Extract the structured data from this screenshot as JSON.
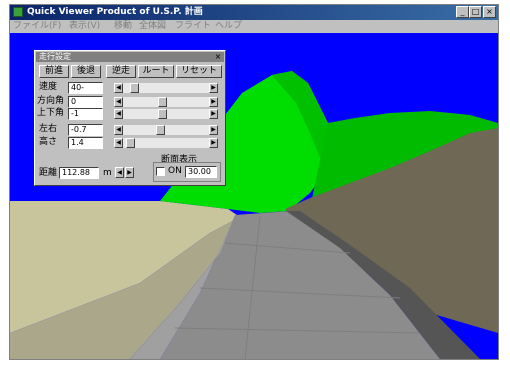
{
  "window": {
    "title": "Quick Viewer Product of U.S.P. 計画",
    "buttons": {
      "minimize": "_",
      "maximize": "□",
      "close": "×"
    }
  },
  "menu": [
    "ファイル(F)",
    "表示(V)",
    "移動",
    "全体図",
    "フライト",
    "ヘルプ"
  ],
  "panel": {
    "title": "走行設定",
    "close_glyph": "×",
    "buttons": [
      "前進",
      "後退",
      "逆走",
      "ルート",
      "リセット"
    ],
    "rows": [
      {
        "label": "速度",
        "value": "40-"
      },
      {
        "label": "方向角",
        "value": "0"
      },
      {
        "label": "上下角",
        "value": "-1"
      },
      {
        "label": "左右",
        "value": "-0.7"
      },
      {
        "label": "高さ",
        "value": "1.4"
      }
    ],
    "distance": {
      "label": "距離",
      "value": "112.88",
      "unit": "m"
    },
    "section_display": {
      "label": "断面表示",
      "check_label": "ON",
      "value": "30.00",
      "checked": false
    }
  },
  "scene": {
    "sky": "#0000ff",
    "grass": "#00dd00",
    "road": "#888888",
    "terrain": "#c8c49c",
    "slope": "#6e6855"
  }
}
